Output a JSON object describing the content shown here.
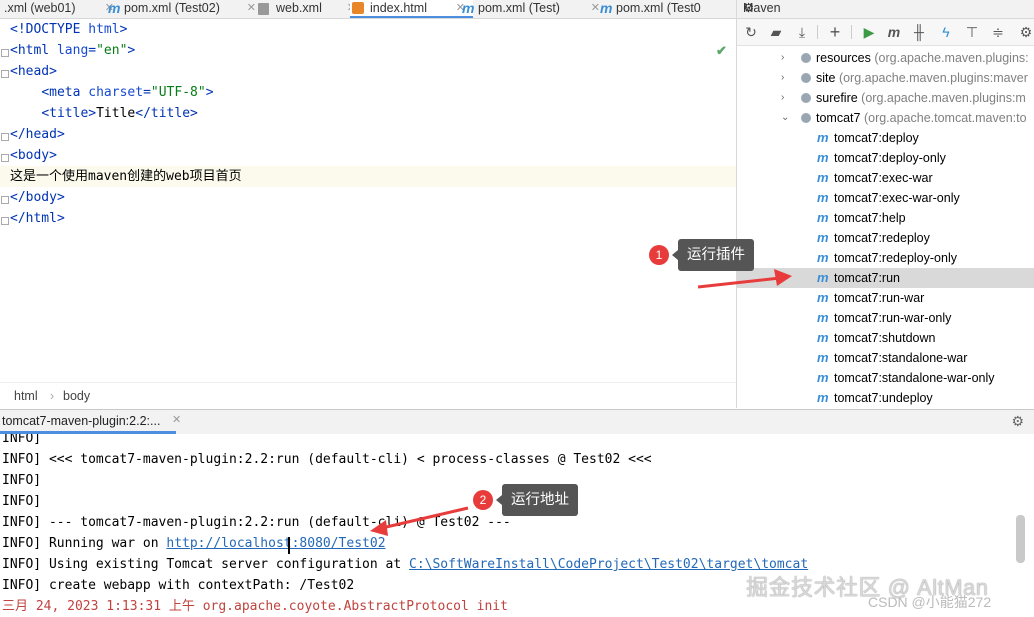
{
  "editor_tabs": [
    {
      "label": ".xml (web01)",
      "icon": "xml-icon"
    },
    {
      "label": "pom.xml (Test02)",
      "icon": "maven-icon"
    },
    {
      "label": "web.xml",
      "icon": "xml-icon"
    },
    {
      "label": "index.html",
      "icon": "html-icon"
    },
    {
      "label": "pom.xml (Test)",
      "icon": "maven-icon"
    },
    {
      "label": "pom.xml (Test0",
      "icon": "maven-icon"
    }
  ],
  "editor": {
    "lines": [
      {
        "parts": [
          [
            "tag",
            "<!DOCTYPE "
          ],
          [
            "attr",
            "html"
          ],
          [
            "tag",
            ">"
          ]
        ]
      },
      {
        "parts": [
          [
            "tag",
            "<html "
          ],
          [
            "attr",
            "lang"
          ],
          [
            "tag",
            "="
          ],
          [
            "val",
            "\"en\""
          ],
          [
            "tag",
            ">"
          ]
        ]
      },
      {
        "parts": [
          [
            "tag",
            "<head>"
          ]
        ]
      },
      {
        "parts": [
          [
            "txt",
            "    "
          ],
          [
            "tag",
            "<meta "
          ],
          [
            "attr",
            "charset"
          ],
          [
            "tag",
            "="
          ],
          [
            "val",
            "\"UTF-8\""
          ],
          [
            "tag",
            ">"
          ]
        ]
      },
      {
        "parts": [
          [
            "txt",
            "    "
          ],
          [
            "tag",
            "<title>"
          ],
          [
            "txt",
            "Title"
          ],
          [
            "tag",
            "</title>"
          ]
        ]
      },
      {
        "parts": [
          [
            "tag",
            "</head>"
          ]
        ]
      },
      {
        "parts": [
          [
            "tag",
            "<body>"
          ]
        ]
      },
      {
        "parts": [
          [
            "txt",
            "这是一个使用maven创建的web项目首页"
          ]
        ]
      },
      {
        "parts": [
          [
            "tag",
            "</body>"
          ]
        ]
      },
      {
        "parts": [
          [
            "tag",
            "</html>"
          ]
        ]
      }
    ]
  },
  "breadcrumbs": [
    "html",
    "body"
  ],
  "maven": {
    "title": "Maven",
    "tree": [
      {
        "label": "resources",
        "detail": "(org.apache.maven.plugins:",
        "type": "plugin",
        "expanded": false
      },
      {
        "label": "site",
        "detail": "(org.apache.maven.plugins:maver",
        "type": "plugin",
        "expanded": false
      },
      {
        "label": "surefire",
        "detail": "(org.apache.maven.plugins:m",
        "type": "plugin",
        "expanded": false
      },
      {
        "label": "tomcat7",
        "detail": "(org.apache.tomcat.maven:to",
        "type": "plugin",
        "expanded": true
      },
      {
        "label": "tomcat7:deploy",
        "type": "goal"
      },
      {
        "label": "tomcat7:deploy-only",
        "type": "goal"
      },
      {
        "label": "tomcat7:exec-war",
        "type": "goal"
      },
      {
        "label": "tomcat7:exec-war-only",
        "type": "goal"
      },
      {
        "label": "tomcat7:help",
        "type": "goal"
      },
      {
        "label": "tomcat7:redeploy",
        "type": "goal"
      },
      {
        "label": "tomcat7:redeploy-only",
        "type": "goal"
      },
      {
        "label": "tomcat7:run",
        "type": "goal",
        "selected": true
      },
      {
        "label": "tomcat7:run-war",
        "type": "goal"
      },
      {
        "label": "tomcat7:run-war-only",
        "type": "goal"
      },
      {
        "label": "tomcat7:shutdown",
        "type": "goal"
      },
      {
        "label": "tomcat7:standalone-war",
        "type": "goal"
      },
      {
        "label": "tomcat7:standalone-war-only",
        "type": "goal"
      },
      {
        "label": "tomcat7:undeploy",
        "type": "goal"
      }
    ]
  },
  "run": {
    "tab_label": "tomcat7-maven-plugin:2.2:...",
    "console": [
      {
        "text": "INFO]"
      },
      {
        "text": "INFO] <<< tomcat7-maven-plugin:2.2:run (default-cli) < process-classes @ Test02 <<<"
      },
      {
        "text": "INFO]"
      },
      {
        "text": "INFO]"
      },
      {
        "text": "INFO] --- tomcat7-maven-plugin:2.2:run (default-cli) @ Test02 ---"
      },
      {
        "text": "INFO] Running war on ",
        "link": "http://localhost:8080/Test02"
      },
      {
        "text": "INFO] Using existing Tomcat server configuration at ",
        "link": "C:\\SoftWareInstall\\CodeProject\\Test02\\target\\tomcat"
      },
      {
        "text": "INFO] create webapp with contextPath: /Test02"
      },
      {
        "text": "三月 24, 2023 1:13:31 上午 org.apache.coyote.AbstractProtocol init",
        "red": true
      }
    ]
  },
  "annotations": [
    {
      "number": "1",
      "label": "运行插件"
    },
    {
      "number": "2",
      "label": "运行地址"
    }
  ],
  "watermark": "掘金技术社区 @ AltMan",
  "watermark2": "CSDN @小能猫272",
  "colors": {
    "accent": "#4c8ee0",
    "badge": "#e83c3c",
    "arrow": "#e83c3c"
  }
}
